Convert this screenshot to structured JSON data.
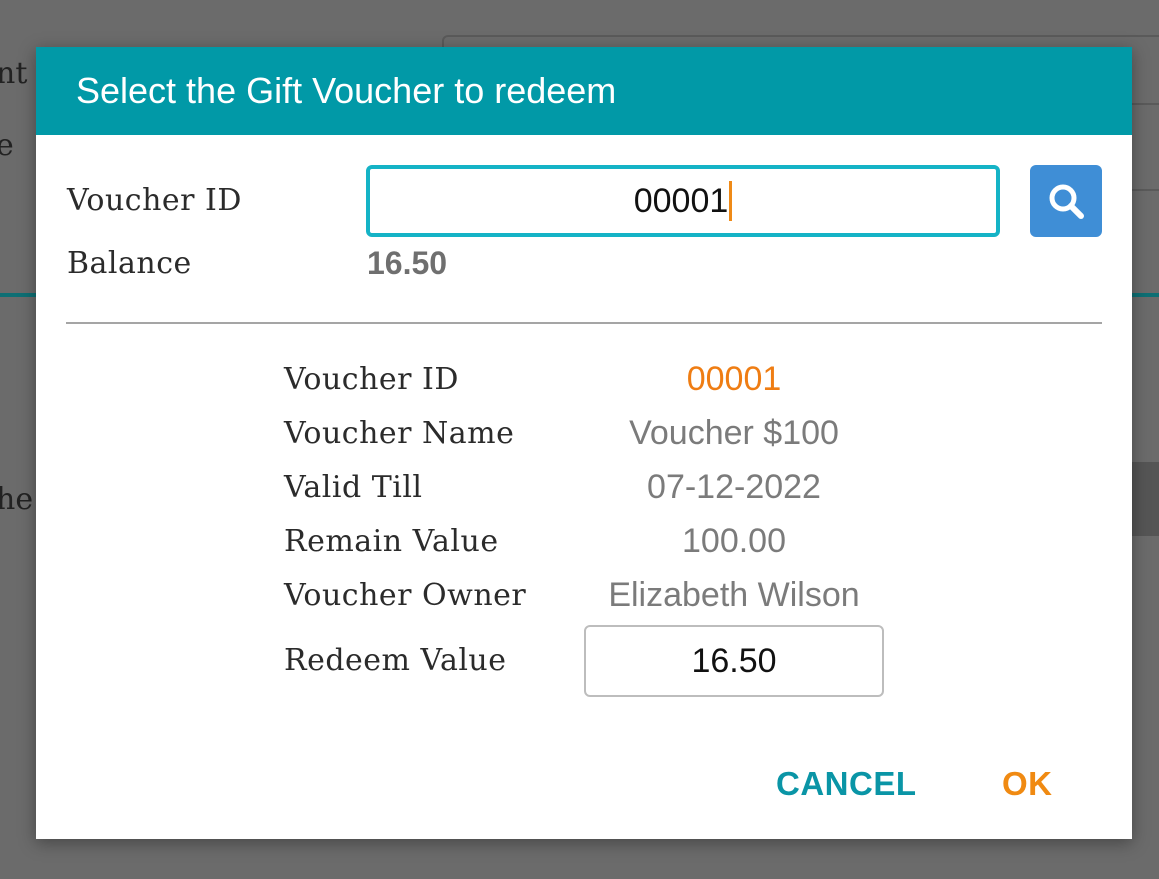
{
  "background": {
    "text_1": "nt",
    "text_2": "e",
    "text_3": "he"
  },
  "dialog": {
    "title": "Select the Gift Voucher to redeem",
    "voucher_id_label": "Voucher ID",
    "voucher_id_value": "00001",
    "search_icon": "search-icon",
    "balance_label": "Balance",
    "balance_value": "16.50",
    "details": [
      {
        "label": "Voucher ID",
        "value": "00001"
      },
      {
        "label": "Voucher Name",
        "value": "Voucher $100"
      },
      {
        "label": "Valid Till",
        "value": "07-12-2022"
      },
      {
        "label": "Remain Value",
        "value": "100.00"
      },
      {
        "label": "Voucher Owner",
        "value": "Elizabeth Wilson"
      }
    ],
    "redeem_label": "Redeem Value",
    "redeem_value": "16.50",
    "cancel_label": "CANCEL",
    "ok_label": "OK"
  },
  "colors": {
    "header": "#0199a7",
    "input_border": "#15b3c6",
    "search_button": "#3f8ed6",
    "accent_orange": "#ef7d13",
    "cancel_teal": "#0a95a6"
  }
}
